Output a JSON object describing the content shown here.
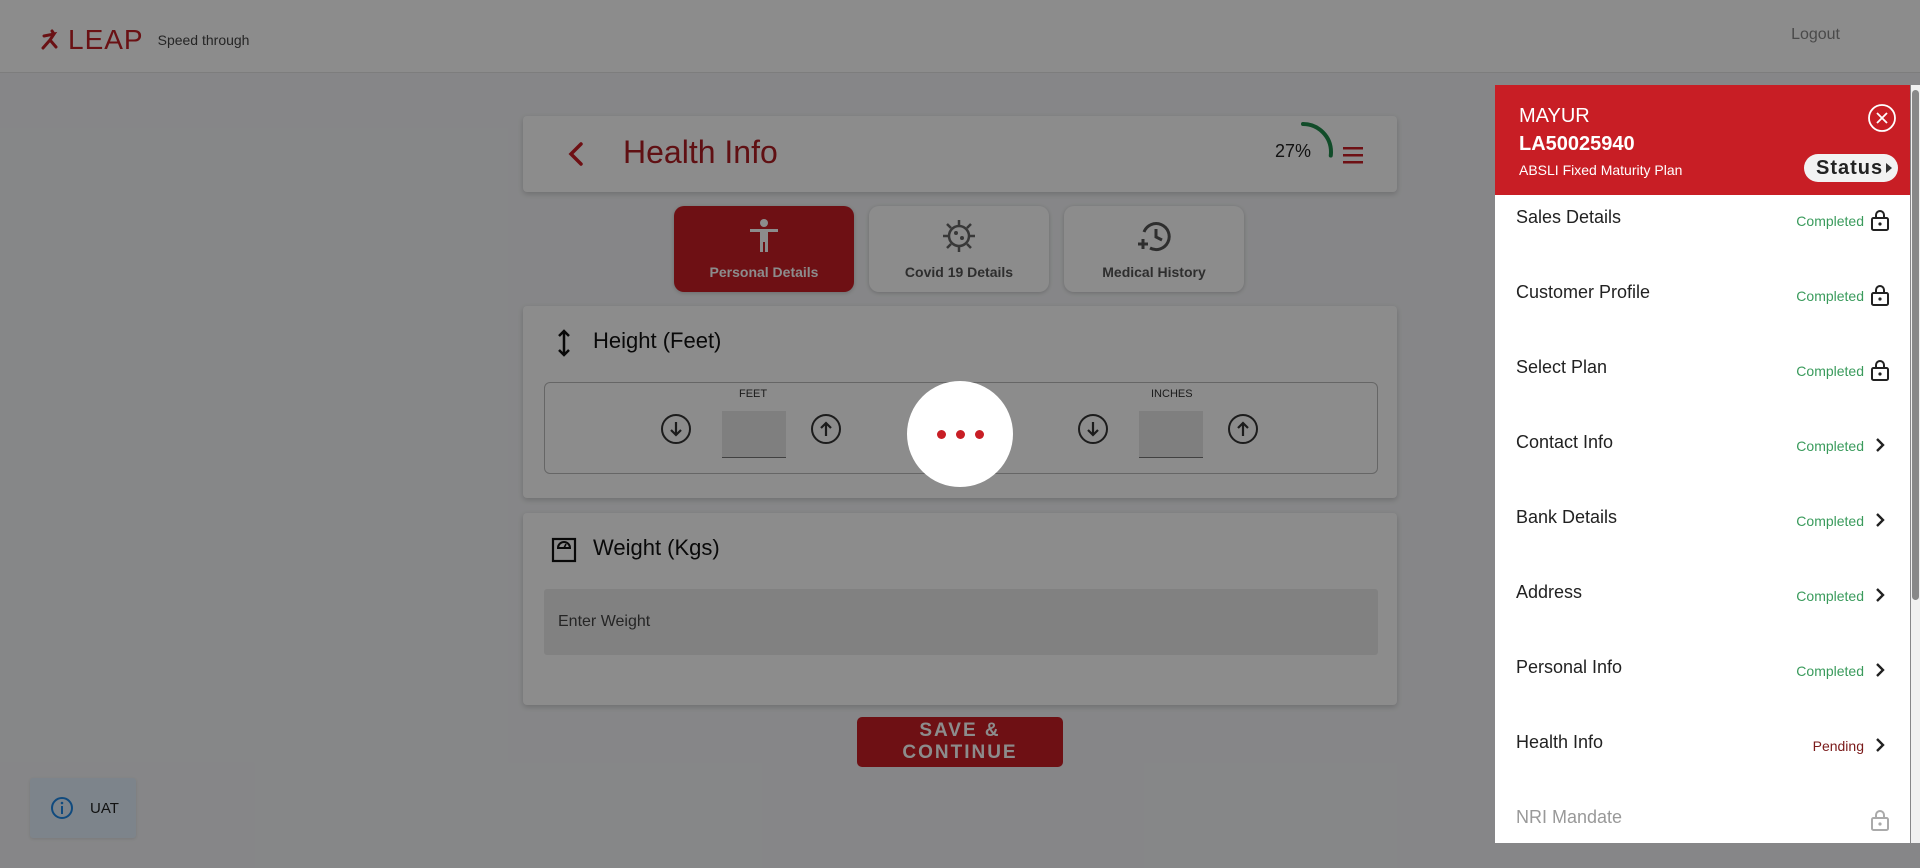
{
  "topbar": {
    "brand": "LEAP",
    "tagline": "Speed through",
    "logout": "Logout"
  },
  "header": {
    "title": "Health Info",
    "progress": "27%",
    "progress_fraction": 0.27
  },
  "tabs": [
    {
      "label": "Personal Details",
      "icon": "person-icon",
      "active": true
    },
    {
      "label": "Covid 19 Details",
      "icon": "virus-icon",
      "active": false
    },
    {
      "label": "Medical History",
      "icon": "history-icon",
      "active": false
    }
  ],
  "height": {
    "title": "Height (Feet)",
    "feet_label": "FEET",
    "inches_label": "INCHES",
    "feet_value": "",
    "inches_value": ""
  },
  "weight": {
    "title": "Weight (Kgs)",
    "placeholder": "Enter Weight",
    "value": ""
  },
  "save_label": "SAVE & CONTINUE",
  "env_badge": "UAT",
  "panel": {
    "name": "MAYUR",
    "policy_id": "LA50025940",
    "plan": "ABSLI Fixed Maturity Plan",
    "status_label": "Status",
    "steps": [
      {
        "name": "Sales Details",
        "status": "Completed",
        "icon": "lock-icon"
      },
      {
        "name": "Customer Profile",
        "status": "Completed",
        "icon": "lock-icon"
      },
      {
        "name": "Select Plan",
        "status": "Completed",
        "icon": "lock-icon"
      },
      {
        "name": "Contact Info",
        "status": "Completed",
        "icon": "chevron-right-icon"
      },
      {
        "name": "Bank Details",
        "status": "Completed",
        "icon": "chevron-right-icon"
      },
      {
        "name": "Address",
        "status": "Completed",
        "icon": "chevron-right-icon"
      },
      {
        "name": "Personal Info",
        "status": "Completed",
        "icon": "chevron-right-icon"
      },
      {
        "name": "Health Info",
        "status": "Pending",
        "icon": "chevron-right-icon"
      },
      {
        "name": "NRI Mandate",
        "status": "",
        "icon": "lock-icon"
      }
    ]
  },
  "colors": {
    "brand_red": "#c81e25",
    "completed_green": "#3a9b5c",
    "progress_green": "#1f8a4c"
  }
}
